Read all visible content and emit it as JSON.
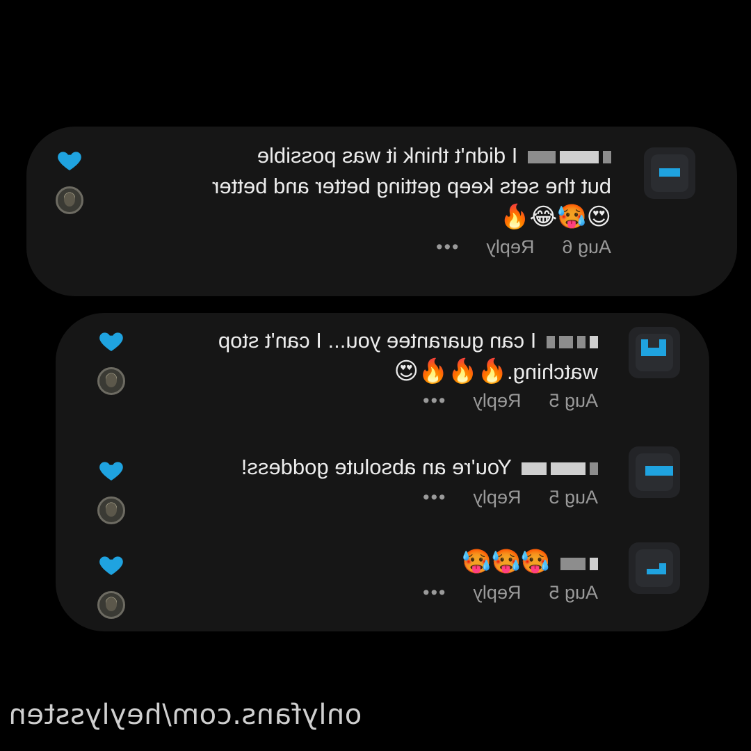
{
  "comments": [
    {
      "lines": [
        "I didn't think it was possible",
        "but the sets keep getting better and better"
      ],
      "emojis": "😍🥵😂🔥",
      "date": "Aug 6",
      "reply": "Reply",
      "more": "•••"
    },
    {
      "lines": [
        "I can guarantee you... I can't stop",
        "watching."
      ],
      "emojis": "🔥🔥🔥😍",
      "date": "Aug 5",
      "reply": "Reply",
      "more": "•••"
    },
    {
      "lines": [
        "You're an absolute goddess!"
      ],
      "date": "Aug 5",
      "reply": "Reply",
      "more": "•••"
    },
    {
      "emojis": "🥵🥵🥵",
      "date": "Aug 5",
      "reply": "Reply",
      "more": "•••"
    }
  ],
  "watermark": "onlyfans.com/heylyssten",
  "colors": {
    "heart": "#1fa3e0",
    "background": "#000000",
    "panel": "#161616"
  },
  "icons": {
    "like": "heart-icon",
    "avatar": "avatar"
  }
}
